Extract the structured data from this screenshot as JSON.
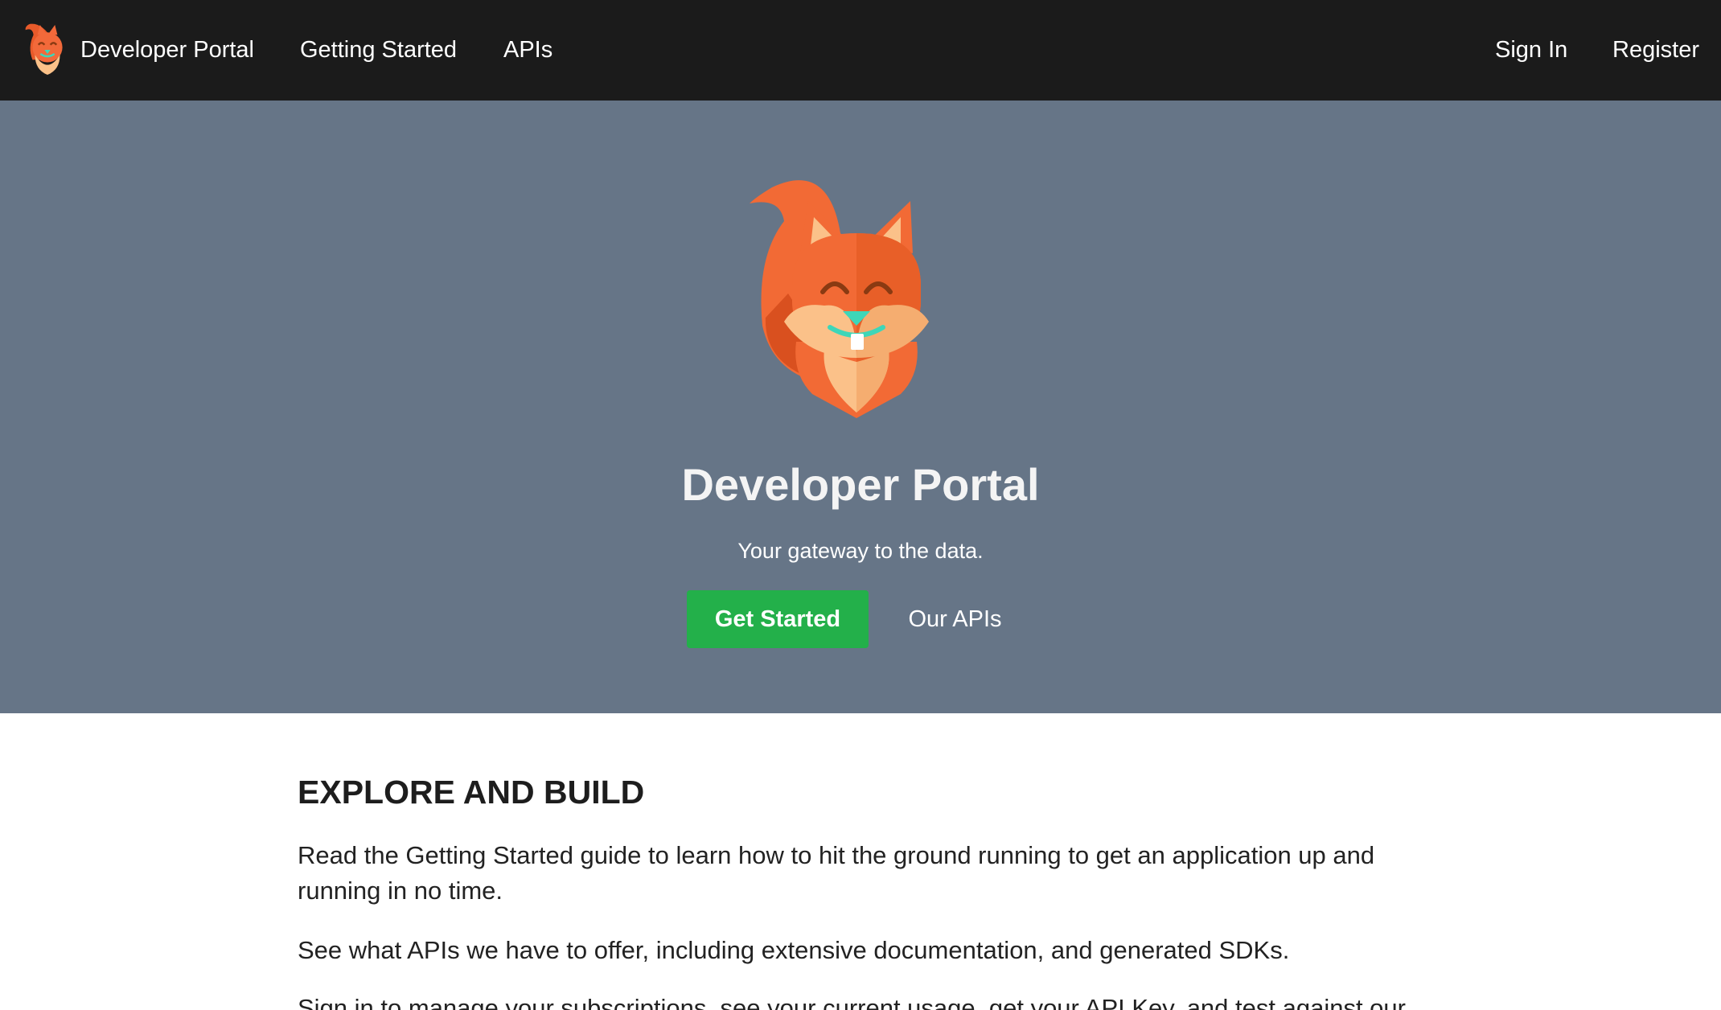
{
  "nav": {
    "brand": "Developer Portal",
    "links": [
      "Getting Started",
      "APIs"
    ],
    "sign_in": "Sign In",
    "register": "Register"
  },
  "hero": {
    "title": "Developer Portal",
    "tagline": "Your gateway to the data.",
    "primary_button": "Get Started",
    "secondary_link": "Our APIs"
  },
  "main": {
    "heading": "EXPLORE AND BUILD",
    "paragraphs": [
      "Read the Getting Started guide to learn how to hit the ground running to get an application up and running in no time.",
      "See what APIs we have to offer, including extensive documentation, and generated SDKs.",
      "Sign in to manage your subscriptions, see your current usage, get your API Key, and test against our"
    ]
  },
  "colors": {
    "navbar": "#1b1b1b",
    "hero_background": "#667587",
    "primary_button": "#23b04a",
    "squirrel_orange": "#f2693a",
    "squirrel_belly": "#fbc189",
    "squirrel_nose": "#3ed6b8"
  },
  "icons": {
    "brand_logo": "squirrel-logo-icon",
    "hero_logo": "squirrel-mascot-icon"
  }
}
